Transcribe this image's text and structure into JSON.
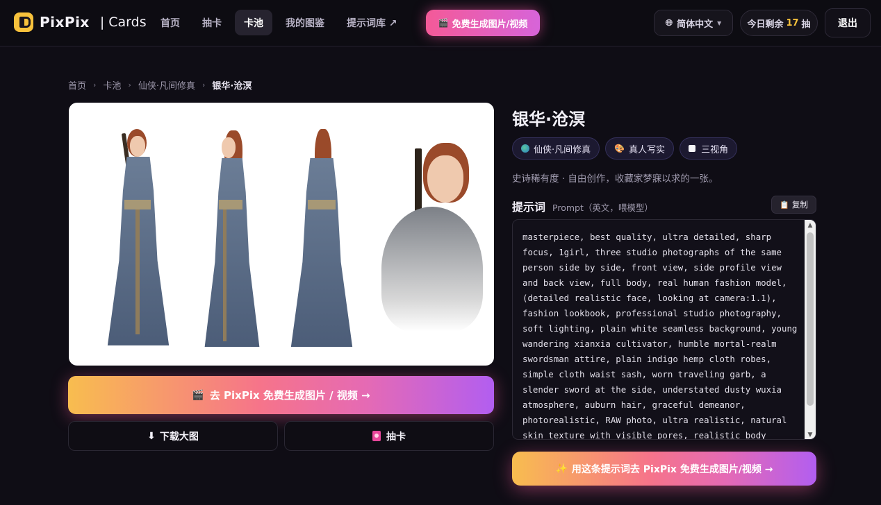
{
  "header": {
    "logo_text": "PixPix",
    "logo_sub": "| Cards",
    "nav": [
      {
        "label": "首页"
      },
      {
        "label": "抽卡"
      },
      {
        "label": "卡池"
      },
      {
        "label": "我的图鉴"
      },
      {
        "label": "提示词库 ↗"
      }
    ],
    "active_nav": "卡池",
    "promo_label": "免费生成图片/视频",
    "language_label": "简体中文",
    "quota_prefix": "今日剩余",
    "quota_count": "17",
    "quota_suffix": "抽",
    "logout_label": "退出"
  },
  "breadcrumb": {
    "items": [
      "首页",
      "卡池",
      "仙侠·凡间修真"
    ],
    "current": "银华·沧溟"
  },
  "card": {
    "title": "银华·沧溟",
    "tags": [
      {
        "label": "仙侠·凡间修真",
        "icon": "globe-icon"
      },
      {
        "label": "真人写实",
        "icon": "palette-icon"
      },
      {
        "label": "三视角",
        "icon": "square-icon"
      }
    ],
    "description": "史诗稀有度 · 自由创作，收藏家梦寐以求的一张。",
    "image_alt": "三视角真人写实角色图"
  },
  "prompt": {
    "heading": "提示词",
    "subheading": "Prompt（英文，喂模型）",
    "copy_label": "复制",
    "text": "masterpiece, best quality, ultra detailed, sharp focus, 1girl, three studio photographs of the same person side by side, front view, side profile view and back view, full body, real human fashion model, (detailed realistic face, looking at camera:1.1), fashion lookbook, professional studio photography, soft lighting, plain white seamless background, young wandering xianxia cultivator, humble mortal-realm swordsman attire, plain indigo hemp cloth robes, simple cloth waist sash, worn traveling garb, a slender sword at the side, understated dusty wuxia atmosphere, auburn hair, graceful demeanor, photorealistic, RAW photo, ultra realistic, natural skin texture with visible pores, realistic body proportions, soft studio"
  },
  "actions": {
    "main_cta": "去 PixPix 免费生成图片 / 视频 →",
    "download_label": "下载大图",
    "draw_label": "抽卡",
    "prompt_cta": "用这条提示词去 PixPix 免费生成图片/视频 →"
  },
  "colors": {
    "accent_yellow": "#f7c23c",
    "accent_pink": "#f45a98",
    "accent_purple": "#b25ef0",
    "background": "#0f0d15"
  }
}
